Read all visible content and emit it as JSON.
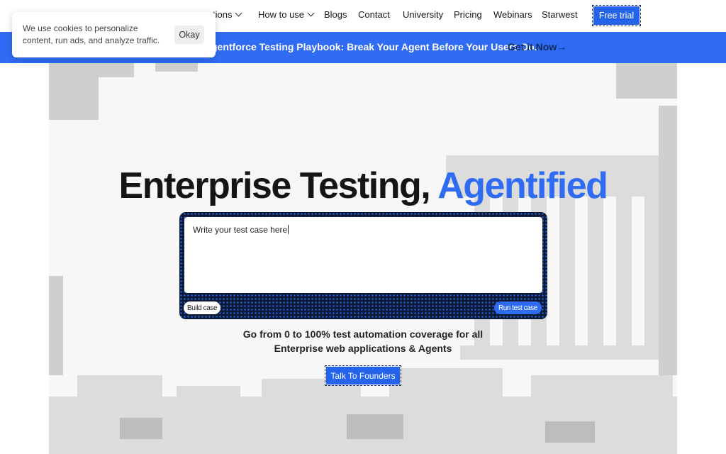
{
  "nav": {
    "items": [
      {
        "label": "tions",
        "has_dropdown": true
      },
      {
        "label": "How to use",
        "has_dropdown": true
      },
      {
        "label": "Blogs",
        "has_dropdown": false
      },
      {
        "label": "Contact",
        "has_dropdown": false
      },
      {
        "label": "University",
        "has_dropdown": false
      },
      {
        "label": "Pricing",
        "has_dropdown": false
      },
      {
        "label": "Webinars",
        "has_dropdown": false
      },
      {
        "label": "Starwest",
        "has_dropdown": false
      }
    ],
    "cta_label": "Free trial"
  },
  "banner": {
    "text": "gentforce Testing Playbook: Break Your Agent Before Your Users Do.",
    "cta": "Get it Now→",
    "color": "#2f6cf3"
  },
  "hero": {
    "headline_plain": "Enterprise Testing,",
    "headline_accent": "Agentified",
    "accent_color": "#2f6cf3",
    "editor": {
      "placeholder": "Write your test case here",
      "build_label": "Build case",
      "run_label": "Run test case"
    },
    "subline_1": "Go from 0 to 100% test automation coverage for all",
    "subline_2": "Enterprise web applications & Agents",
    "cta_label": "Talk To Founders"
  },
  "cookie": {
    "text": "We use cookies to personalize content, run ads, and analyze traffic.",
    "button": "Okay"
  },
  "icons": {
    "dropdown": "chevron-down-icon"
  }
}
